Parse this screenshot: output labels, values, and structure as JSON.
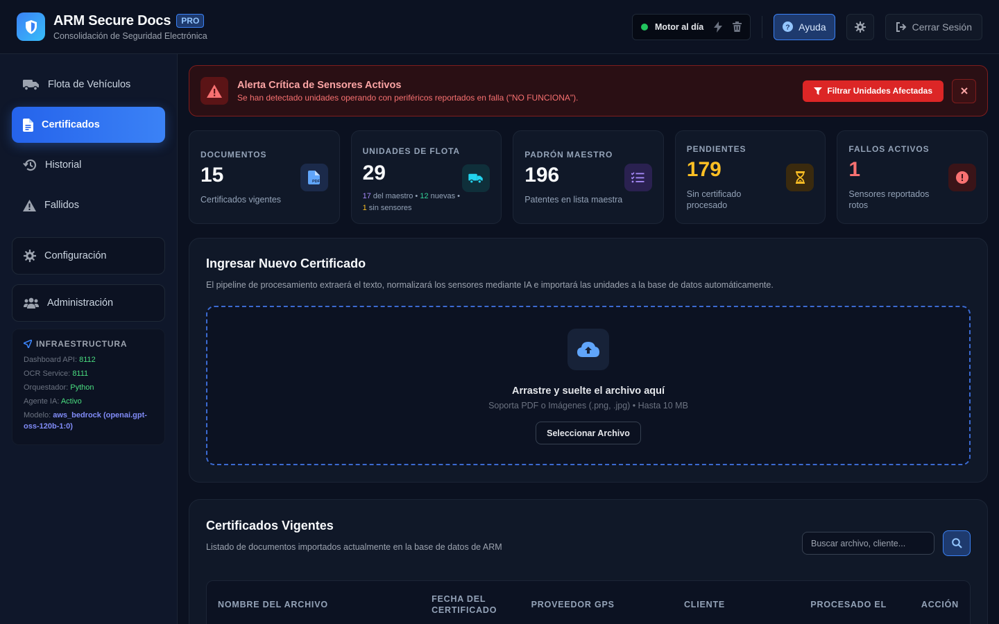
{
  "header": {
    "brand_title": "ARM Secure Docs",
    "brand_badge": "PRO",
    "brand_subtitle": "Consolidación de Seguridad Electrónica",
    "engine_status": "Motor al día",
    "help_label": "Ayuda",
    "logout_label": "Cerrar Sesión"
  },
  "sidebar": {
    "items": [
      {
        "label": "Flota de Vehículos",
        "icon": "truck-icon"
      },
      {
        "label": "Certificados",
        "icon": "file-icon"
      },
      {
        "label": "Historial",
        "icon": "history-icon"
      },
      {
        "label": "Fallidos",
        "icon": "warning-icon"
      }
    ],
    "config_label": "Configuración",
    "admin_label": "Administración",
    "infra": {
      "title": "INFRAESTRUCTURA",
      "dashboard_key": "Dashboard API:",
      "dashboard_val": "8112",
      "ocr_key": "OCR Service:",
      "ocr_val": "8111",
      "orq_key": "Orquestador:",
      "orq_val": "Python",
      "agent_key": "Agente IA:",
      "agent_val": "Activo",
      "model_key": "Modelo:",
      "model_val": "aws_bedrock (openai.gpt-oss-120b-1:0)"
    }
  },
  "alert": {
    "title": "Alerta Crítica de Sensores Activos",
    "description": "Se han detectado unidades operando con periféricos reportados en falla (\"NO FUNCIONA\").",
    "filter_label": "Filtrar Unidades Afectadas"
  },
  "stats": [
    {
      "label": "DOCUMENTOS",
      "value": "15",
      "caption": "Certificados vigentes"
    },
    {
      "label": "UNIDADES DE FLOTA",
      "value": "29",
      "mini_a": "17",
      "mini_a_text": " del maestro • ",
      "mini_b": "12",
      "mini_b_text": " nuevas •",
      "mini_c": "1",
      "mini_c_text": " sin sensores"
    },
    {
      "label": "PADRÓN MAESTRO",
      "value": "196",
      "caption": "Patentes en lista maestra"
    },
    {
      "label": "PENDIENTES",
      "value": "179",
      "caption": "Sin certificado procesado"
    },
    {
      "label": "FALLOS ACTIVOS",
      "value": "1",
      "caption": "Sensores reportados rotos"
    }
  ],
  "upload": {
    "title": "Ingresar Nuevo Certificado",
    "description": "El pipeline de procesamiento extraerá el texto, normalizará los sensores mediante IA e importará las unidades a la base de datos automáticamente.",
    "drop_title": "Arrastre y suelte el archivo aquí",
    "drop_sub": "Soporta PDF o Imágenes (.png, .jpg) • Hasta 10 MB",
    "select_label": "Seleccionar Archivo"
  },
  "certs": {
    "title": "Certificados Vigentes",
    "description": "Listado de documentos importados actualmente en la base de datos de ARM",
    "search_placeholder": "Buscar archivo, cliente...",
    "columns": [
      "NOMBRE DEL ARCHIVO",
      "FECHA DEL CERTIFICADO",
      "PROVEEDOR GPS",
      "CLIENTE",
      "PROCESADO EL",
      "ACCIÓN"
    ]
  },
  "colors": {
    "accent": "#3b82f6",
    "danger": "#dc2626",
    "success": "#22c55e",
    "warning": "#fbbf24"
  }
}
